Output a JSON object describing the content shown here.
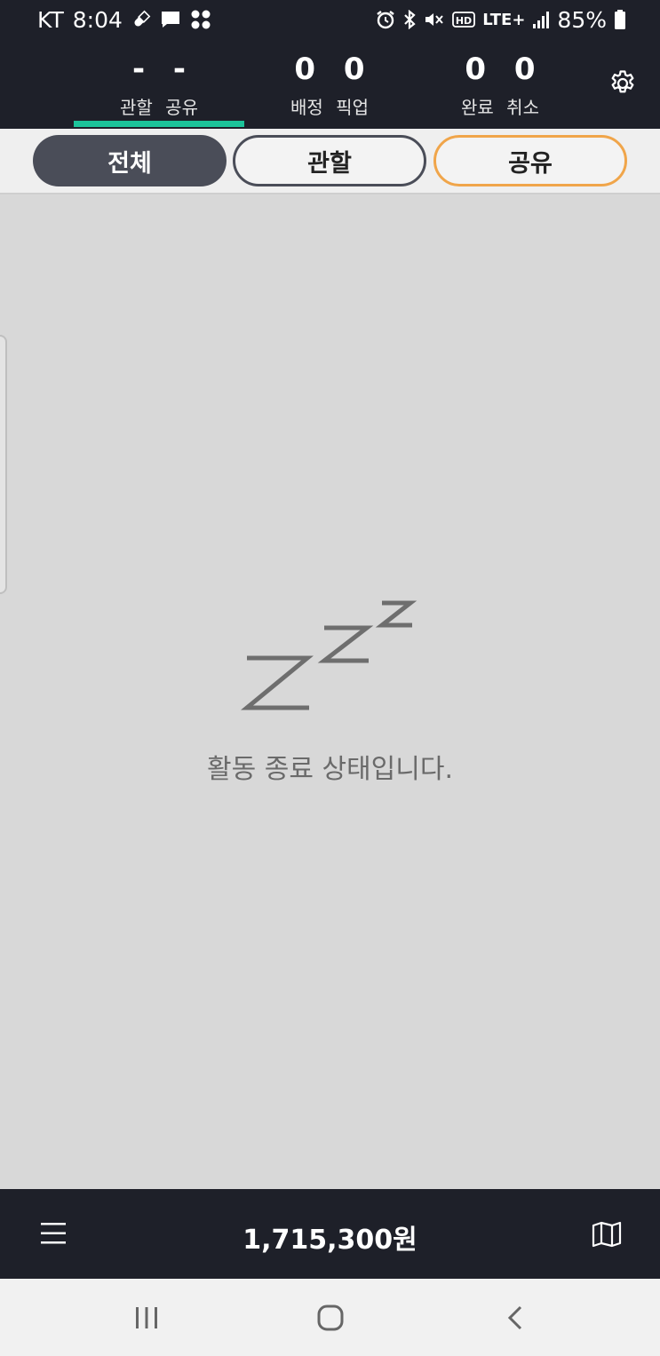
{
  "status_bar": {
    "carrier": "KT",
    "time": "8:04",
    "network": "LTE+",
    "battery": "85%",
    "left_icons": [
      "pill-icon",
      "message-icon",
      "app-grid-icon"
    ],
    "right_icons": [
      "alarm-icon",
      "bluetooth-icon",
      "mute-icon",
      "hd-icon",
      "signal-icon",
      "battery-icon"
    ]
  },
  "header": {
    "stats": [
      {
        "value": "- -",
        "label": "관할 공유"
      },
      {
        "value": "0 0",
        "label": "배정 픽업"
      },
      {
        "value": "0 0",
        "label": "완료 취소"
      }
    ],
    "active_stat": 0,
    "accent": "#1cc49a"
  },
  "filters": {
    "all": "전체",
    "jurisdiction": "관할",
    "share": "공유",
    "selected": "전체",
    "share_border_color": "#f0a54a"
  },
  "main": {
    "idle_message": "활동 종료 상태입니다."
  },
  "bottom_bar": {
    "earnings": "1,715,300원"
  },
  "colors": {
    "dark_bg": "#1e2029",
    "content_bg": "#d8d8d8"
  }
}
